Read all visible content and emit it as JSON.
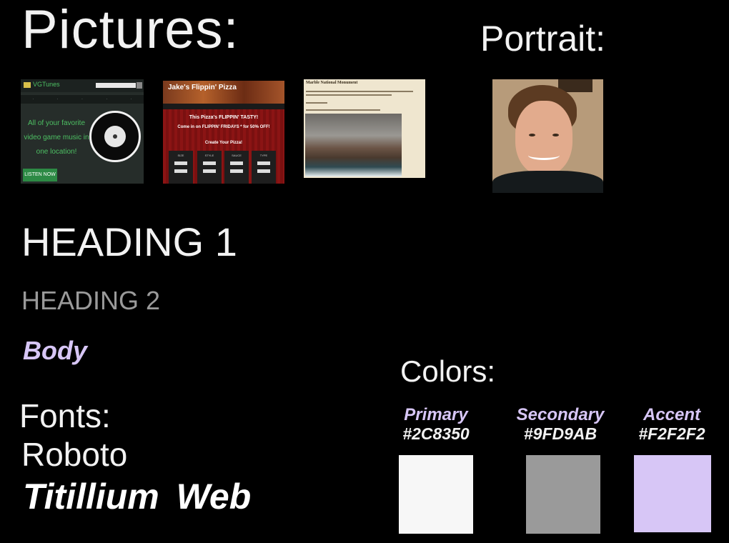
{
  "headings": {
    "pictures": "Pictures:",
    "portrait": "Portrait:",
    "colors": "Colors:",
    "fonts": "Fonts:"
  },
  "typography": {
    "heading1": "HEADING 1",
    "heading2": "HEADING 2",
    "body": "Body"
  },
  "fonts": [
    "Roboto",
    "Titillium  Web"
  ],
  "thumbnails": {
    "vgtunes": {
      "brand": "VGTunes",
      "tagline": "All of your favorite video game music in one location!",
      "button": "LISTEN NOW"
    },
    "pizza": {
      "title": "Jake's Flippin' Pizza",
      "line1": "This Pizza's FLIPPIN' TASTY!",
      "line2": "Come in on FLIPPIN' FRIDAYS * for 50% OFF!",
      "line3": "Create Your Pizza!",
      "columns": [
        "SIZE",
        "STYLE",
        "SAUCE",
        "TYPE"
      ]
    },
    "monument": {
      "title": "Marble National Monument"
    }
  },
  "colors": [
    {
      "name": "Primary",
      "hex": "#2C8350",
      "swatch": "#f7f7f7"
    },
    {
      "name": "Secondary",
      "hex": "#9FD9AB",
      "swatch": "#9a9a9a"
    },
    {
      "name": "Accent",
      "hex": "#F2F2F2",
      "swatch": "#d7c6f6"
    }
  ]
}
